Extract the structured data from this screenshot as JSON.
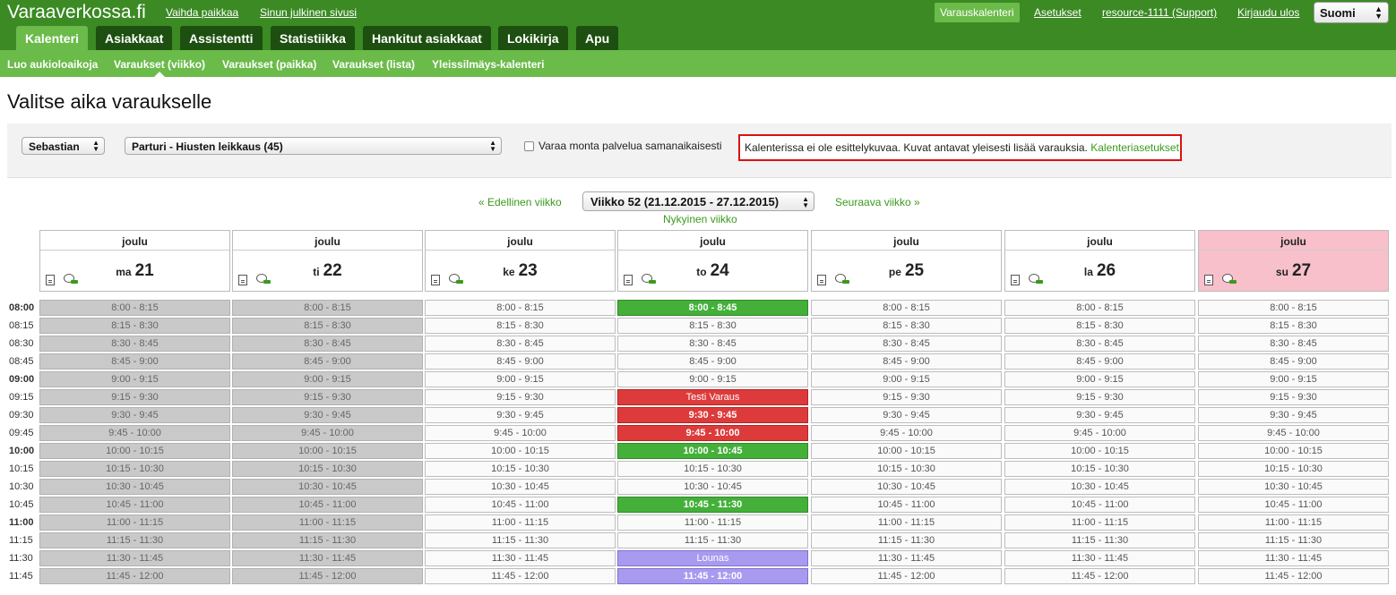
{
  "app": {
    "logo": "Varaaverkossa.fi",
    "links": {
      "change_place": "Vaihda paikkaa",
      "public_page": "Sinun julkinen sivusi",
      "booking_calendar": "Varauskalenteri",
      "settings": "Asetukset",
      "resource": "resource-1111 (Support)",
      "logout": "Kirjaudu ulos"
    },
    "language": "Suomi"
  },
  "tabs": [
    {
      "label": "Kalenteri",
      "active": true
    },
    {
      "label": "Asiakkaat"
    },
    {
      "label": "Assistentti"
    },
    {
      "label": "Statistiikka"
    },
    {
      "label": "Hankitut asiakkaat"
    },
    {
      "label": "Lokikirja"
    },
    {
      "label": "Apu"
    }
  ],
  "subnav": [
    {
      "label": "Luo aukioloaikoja"
    },
    {
      "label": "Varaukset (viikko)",
      "active": true
    },
    {
      "label": "Varaukset (paikka)"
    },
    {
      "label": "Varaukset (lista)"
    },
    {
      "label": "Yleissilmäys-kalenteri"
    }
  ],
  "page_title": "Valitse aika varaukselle",
  "filters": {
    "staff": "Sebastian",
    "service": "Parturi - Hiusten leikkaus (45)",
    "multi_label": "Varaa monta palvelua samanaikaisesti",
    "notice_text": "Kalenterissa ei ole esittelykuvaa. Kuvat antavat yleisesti lisää varauksia.",
    "notice_link": "Kalenteriasetukset"
  },
  "week": {
    "prev": "« Edellinen viikko",
    "next": "Seuraava viikko »",
    "selected": "Viikko 52 (21.12.2015 - 27.12.2015)",
    "current": "Nykyinen viikko"
  },
  "days": [
    {
      "month": "joulu",
      "weekday": "ma",
      "num": "21"
    },
    {
      "month": "joulu",
      "weekday": "ti",
      "num": "22"
    },
    {
      "month": "joulu",
      "weekday": "ke",
      "num": "23"
    },
    {
      "month": "joulu",
      "weekday": "to",
      "num": "24"
    },
    {
      "month": "joulu",
      "weekday": "pe",
      "num": "25"
    },
    {
      "month": "joulu",
      "weekday": "la",
      "num": "26"
    },
    {
      "month": "joulu",
      "weekday": "su",
      "num": "27"
    }
  ],
  "times": [
    "08:00",
    "08:15",
    "08:30",
    "08:45",
    "09:00",
    "09:15",
    "09:30",
    "09:45",
    "10:00",
    "10:15",
    "10:30",
    "10:45",
    "11:00",
    "11:15",
    "11:30",
    "11:45"
  ],
  "slot_labels": [
    "8:00 - 8:15",
    "8:15 - 8:30",
    "8:30 - 8:45",
    "8:45 - 9:00",
    "9:00 - 9:15",
    "9:15 - 9:30",
    "9:30 - 9:45",
    "9:45 - 10:00",
    "10:00 - 10:15",
    "10:15 - 10:30",
    "10:30 - 10:45",
    "10:45 - 11:00",
    "11:00 - 11:15",
    "11:15 - 11:30",
    "11:30 - 11:45",
    "11:45 - 12:00"
  ],
  "thursday_slots": [
    {
      "label": "8:00 - 8:45",
      "kind": "booked-green"
    },
    {
      "label": "8:15 - 8:30",
      "kind": "open"
    },
    {
      "label": "8:30 - 8:45",
      "kind": "open"
    },
    {
      "label": "8:45 - 9:00",
      "kind": "open"
    },
    {
      "label": "9:00 - 9:15",
      "kind": "open"
    },
    {
      "label": "Testi Varaus",
      "kind": "booked-red normal"
    },
    {
      "label": "9:30 - 9:45",
      "kind": "booked-red"
    },
    {
      "label": "9:45 - 10:00",
      "kind": "booked-red"
    },
    {
      "label": "10:00 - 10:45",
      "kind": "booked-green"
    },
    {
      "label": "10:15 - 10:30",
      "kind": "open"
    },
    {
      "label": "10:30 - 10:45",
      "kind": "open"
    },
    {
      "label": "10:45 - 11:30",
      "kind": "booked-green"
    },
    {
      "label": "11:00 - 11:15",
      "kind": "open"
    },
    {
      "label": "11:15 - 11:30",
      "kind": "open"
    },
    {
      "label": "Lounas",
      "kind": "lunch"
    },
    {
      "label": "11:45 - 12:00",
      "kind": "lunch bold"
    }
  ],
  "past_days": [
    0,
    1
  ],
  "colors": {
    "header_dark": "#3b8a24",
    "accent_green": "#6bbb4a",
    "tab_dark": "#1d4f10",
    "booked_green": "#44b03a",
    "booked_red": "#dd3b3b",
    "lunch": "#a99af0",
    "sunday": "#f7c0cb",
    "past": "#c9c9c9",
    "notice_border": "#dd1111"
  }
}
